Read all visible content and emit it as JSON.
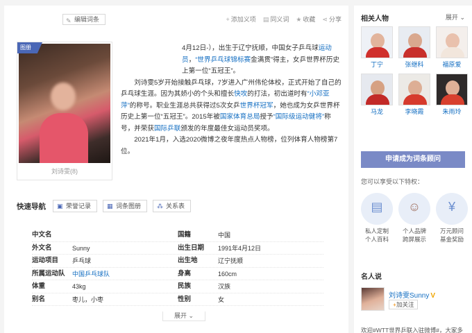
{
  "header": {
    "edit_label": "编辑词条",
    "actions": [
      "添加义项",
      "同义词",
      "收藏",
      "分享"
    ]
  },
  "album": {
    "tag": "图册",
    "caption": "刘诗雯(8)"
  },
  "intro": {
    "p1_a": "4月12日-），出生于辽宁抚顺，中国女子乒乓球",
    "p1_link1": "运动员",
    "p1_b": "，",
    "p1_link2": "“世界乒乓球锦标赛",
    "p1_c": "金满贯”得主，女乒世界杯历史上第一位“五冠王”。",
    "p2_a": "刘诗雯5岁开始接触乒乓球，7岁进入广州伟伦体校，正式开始了自己的乒乓球生涯。因为其娇小的个头和擅长",
    "p2_link1": "快攻",
    "p2_b": "的打法，初出道时有",
    "p2_link2": "“小邓亚萍”",
    "p2_c": "的称号。职业生涯总共获得过5次女乒",
    "p2_link3": "世界杯冠军",
    "p2_d": "，她也成为女乒世界杯历史上第一位“五冠王”。2015年被",
    "p2_link4": "国家体育总局",
    "p2_e": "授予",
    "p2_link5": "“国际级运动健将”",
    "p2_f": "称号，并荣获",
    "p2_link6": "国际乒联",
    "p2_g": "颁发的年度最佳女运动员奖项。",
    "p3": "2021年1月，入选2020微博之夜年度热点人物榜，位列体育人物榜第7位。"
  },
  "quick_nav": {
    "title": "快速导航",
    "buttons": [
      "荣誉记录",
      "词条图册",
      "关系表"
    ]
  },
  "info_rows": [
    {
      "k1": "中文名",
      "v1": "",
      "k2": "国籍",
      "v2": "中国"
    },
    {
      "k1": "外文名",
      "v1": "Sunny",
      "k2": "出生日期",
      "v2": "1991年4月12日"
    },
    {
      "k1": "运动项目",
      "v1": "乒乓球",
      "k2": "出生地",
      "v2": "辽宁抚顺"
    },
    {
      "k1": "所属运动队",
      "v1": "中国乒乓球队",
      "k2": "身高",
      "v2": "160cm"
    },
    {
      "k1": "体重",
      "v1": "43kg",
      "k2": "民族",
      "v2": "汉族"
    },
    {
      "k1": "别名",
      "v1": "枣儿，小枣",
      "k2": "性别",
      "v2": "女"
    }
  ],
  "expand_label": "展开",
  "sidebar": {
    "title": "相关人物",
    "more": "展开",
    "persons": [
      {
        "name": "丁宁",
        "color": "#d0302c"
      },
      {
        "name": "张继科",
        "color": "#c8302c"
      },
      {
        "name": "福原爱",
        "color": "#f2e6dc"
      },
      {
        "name": "马龙",
        "color": "#c22a28"
      },
      {
        "name": "李晓霞",
        "color": "#d63a2c"
      },
      {
        "name": "朱雨玲",
        "color": "#d8402e"
      }
    ],
    "apply_label": "申请成为词条顾问",
    "privilege_title": "您可以享受以下特权：",
    "privileges": [
      {
        "l1": "私人定制",
        "l2": "个人百科"
      },
      {
        "l1": "个人品牌",
        "l2": "跨屏展示"
      },
      {
        "l1": "万元顾问",
        "l2": "基金奖励"
      }
    ],
    "ms_title": "名人说",
    "ms_name": "刘诗雯Sunny",
    "ms_follow": "加关注",
    "ms_text": "欢迎#WTT世界乒联入驻微博#，大家多"
  },
  "colors": {
    "link": "#136ec2",
    "accent": "#4a67b6",
    "apply": "#7a8ac6"
  }
}
